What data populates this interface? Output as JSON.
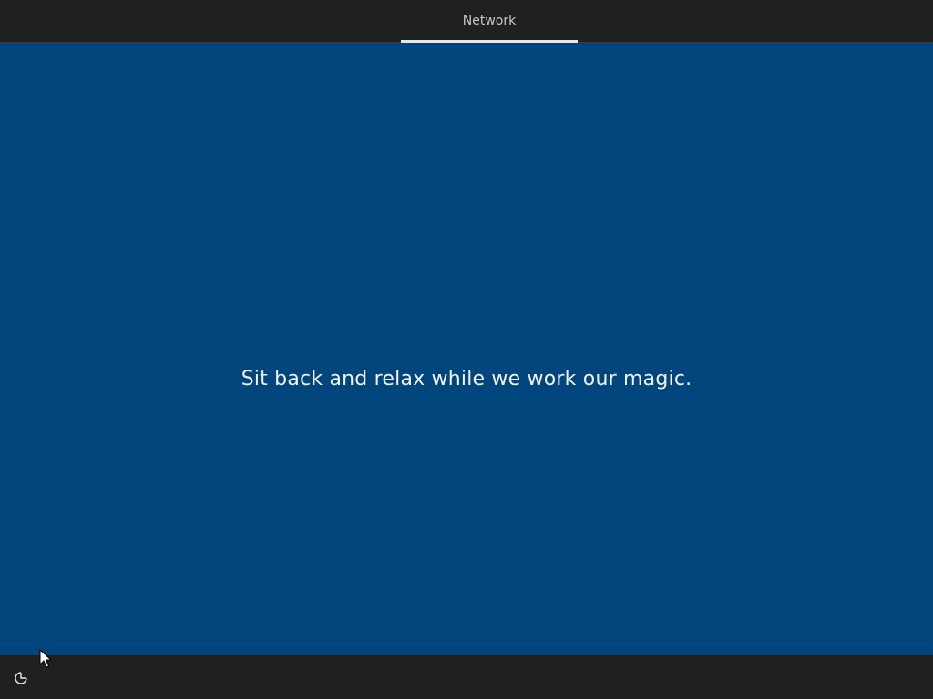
{
  "header": {
    "current_step": "Network"
  },
  "main": {
    "message": "Sit back and relax while we work our magic."
  },
  "footer": {
    "accessibility_icon": "ease-of-access-icon"
  },
  "colors": {
    "background_blue": "#00457c",
    "bar_dark": "#202020",
    "text_light": "#f2f2f2",
    "tab_text": "#c8c8c8",
    "underline": "#e8e8e8"
  }
}
